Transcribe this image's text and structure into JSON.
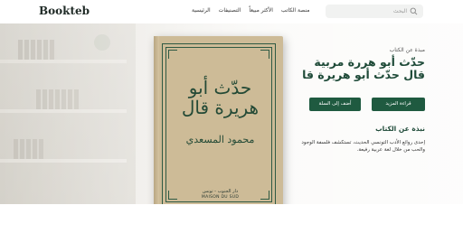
{
  "header": {
    "logo": "Bookteb",
    "nav": [
      "الرئيسية",
      "التصنيفات",
      "الأكثر مبيعاً",
      "منصة الكاتب"
    ],
    "search_placeholder": "البحث"
  },
  "book_cover": {
    "title": "حدّث أبو هريرة قال",
    "author": "محمود المسعدي",
    "publisher_ar": "دار الجنوب - تونس",
    "publisher_en": "MAISON DU SUD"
  },
  "info": {
    "label": "مبذة عن الكتاب",
    "title": "حدّث أبو هررة مربية قال حدّث أبو هريرة قا",
    "read_more": "قراءة المزيد",
    "add_to_cart": "أضف إلى السلة"
  },
  "about": {
    "heading": "نبذة عن الكتاب",
    "text": "إحدى روائع الأدب التونسي الحديث، تستكشف فلسفة الوجود والحب من خلال لغة عربية رفيعة."
  },
  "colors": {
    "accent": "#1f5a40",
    "cover": "#cdbb97"
  }
}
